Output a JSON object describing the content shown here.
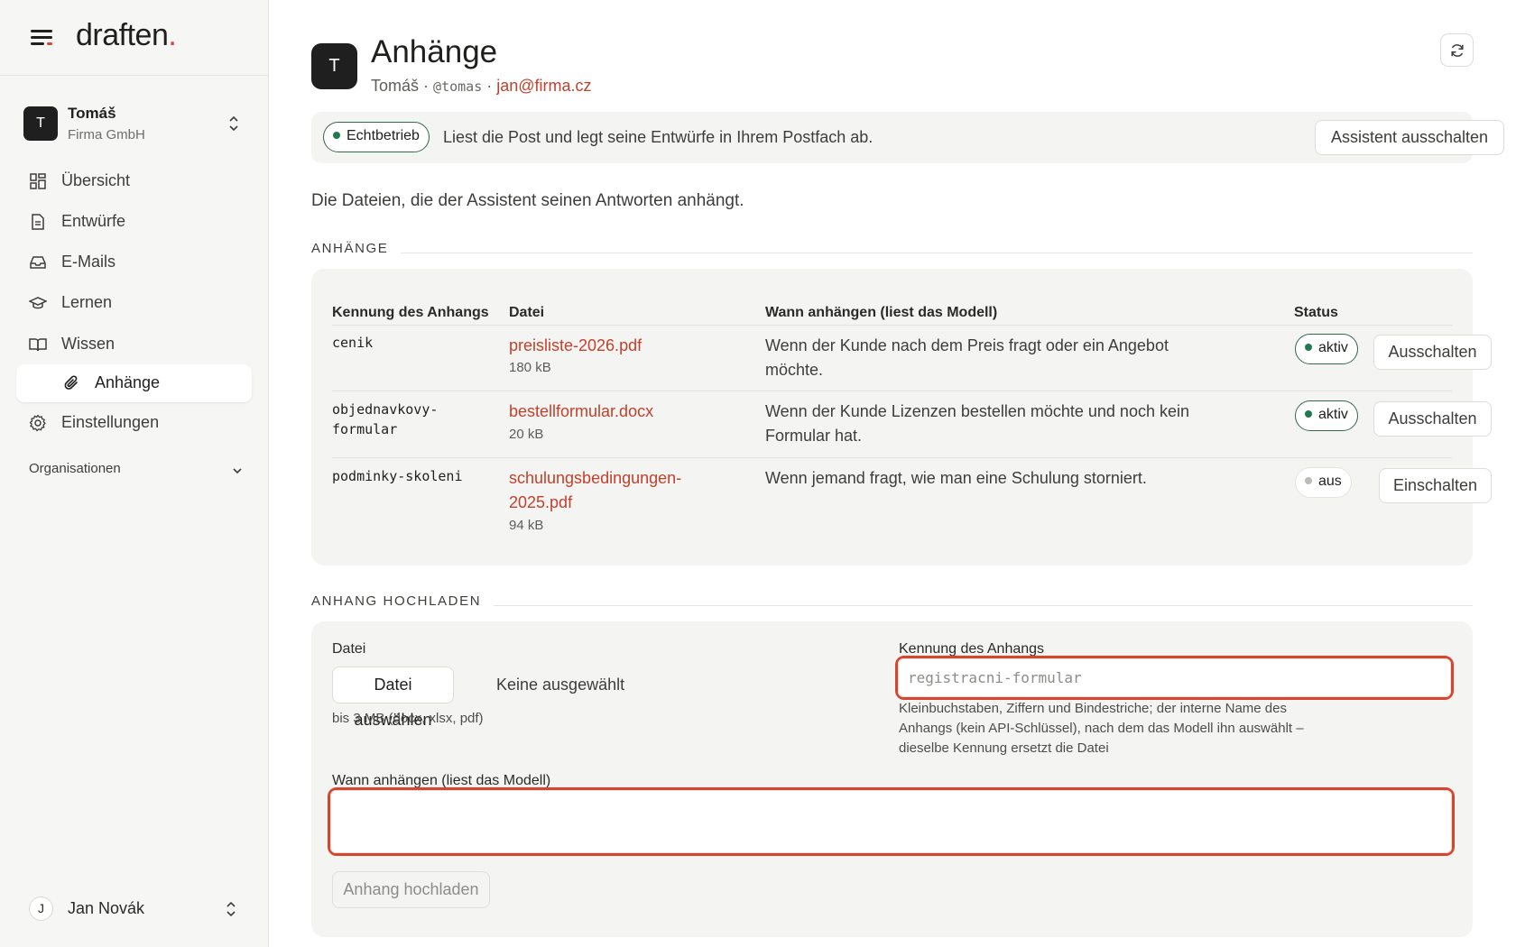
{
  "sidebar": {
    "brand": {
      "name": "draften",
      "dot": "."
    },
    "org": {
      "avatar_letter": "T",
      "name": "Tomáš",
      "subtitle": "Firma GmbH"
    },
    "items": [
      {
        "label": "Übersicht",
        "icon": "dashboard-icon"
      },
      {
        "label": "Entwürfe",
        "icon": "document-icon"
      },
      {
        "label": "E-Mails",
        "icon": "inbox-icon"
      },
      {
        "label": "Lernen",
        "icon": "graduation-cap-icon"
      },
      {
        "label": "Wissen",
        "icon": "book-icon"
      },
      {
        "label": "Anhänge",
        "icon": "paperclip-icon",
        "active": true
      },
      {
        "label": "Einstellungen",
        "icon": "gear-icon"
      }
    ],
    "organisations_label": "Organisationen",
    "user": {
      "avatar_letter": "J",
      "name": "Jan Novák"
    }
  },
  "header": {
    "avatar_letter": "T",
    "title": "Anhänge",
    "user_name": "Tomáš",
    "separator": "·",
    "handle": "@tomas",
    "email": "jan@firma.cz"
  },
  "banner": {
    "status_label": "Echtbetrieb",
    "text": "Liest die Post und legt seine Entwürfe in Ihrem Postfach ab.",
    "button_label": "Assistent ausschalten"
  },
  "intro": "Die Dateien, die der Assistent seinen Antworten anhängt.",
  "attachments_section": {
    "title": "ANHÄNGE",
    "columns": [
      "Kennung des Anhangs",
      "Datei",
      "Wann anhängen (liest das Modell)",
      "Status"
    ],
    "rows": [
      {
        "id_lines": [
          "cenik"
        ],
        "file_lines": [
          "preisliste-2026.pdf"
        ],
        "size": "180 kB",
        "when_lines": [
          "Wenn der Kunde nach dem Preis fragt oder ein Angebot",
          "möchte."
        ],
        "status": "aktiv",
        "action": "Ausschalten"
      },
      {
        "id_lines": [
          "objednavkovy-",
          "formular"
        ],
        "file_lines": [
          "bestellformular.docx"
        ],
        "size": "20 kB",
        "when_lines": [
          "Wenn der Kunde Lizenzen bestellen möchte und noch kein",
          "Formular hat."
        ],
        "status": "aktiv",
        "action": "Ausschalten"
      },
      {
        "id_lines": [
          "podminky-skoleni"
        ],
        "file_lines": [
          "schulungsbedingungen-",
          "2025.pdf"
        ],
        "size": "94 kB",
        "when_lines": [
          "Wenn jemand fragt, wie man eine Schulung storniert."
        ],
        "status": "aus",
        "action": "Einschalten"
      }
    ]
  },
  "upload_section": {
    "title": "ANHANG HOCHLADEN",
    "file_label": "Datei",
    "file_button": "Datei auswählen",
    "file_none": "Keine ausgewählt",
    "file_hint": "bis 3 MB (docx, xlsx, pdf)",
    "id_label": "Kennung des Anhangs",
    "id_placeholder": "registracni-formular",
    "id_hint_lines": [
      "Kleinbuchstaben, Ziffern und Bindestriche; der interne Name des",
      "Anhangs (kein API-Schlüssel), nach dem das Modell ihn auswählt –",
      "dieselbe Kennung ersetzt die Datei"
    ],
    "when_label": "Wann anhängen (liest das Modell)",
    "when_value": "",
    "submit_label": "Anhang hochladen"
  },
  "colors": {
    "accent": "#d6452d",
    "link": "#c2412b",
    "active_green": "#1f7a4f",
    "sidebar_bg": "#f6f6f4",
    "card_bg": "#f4f4f2"
  }
}
